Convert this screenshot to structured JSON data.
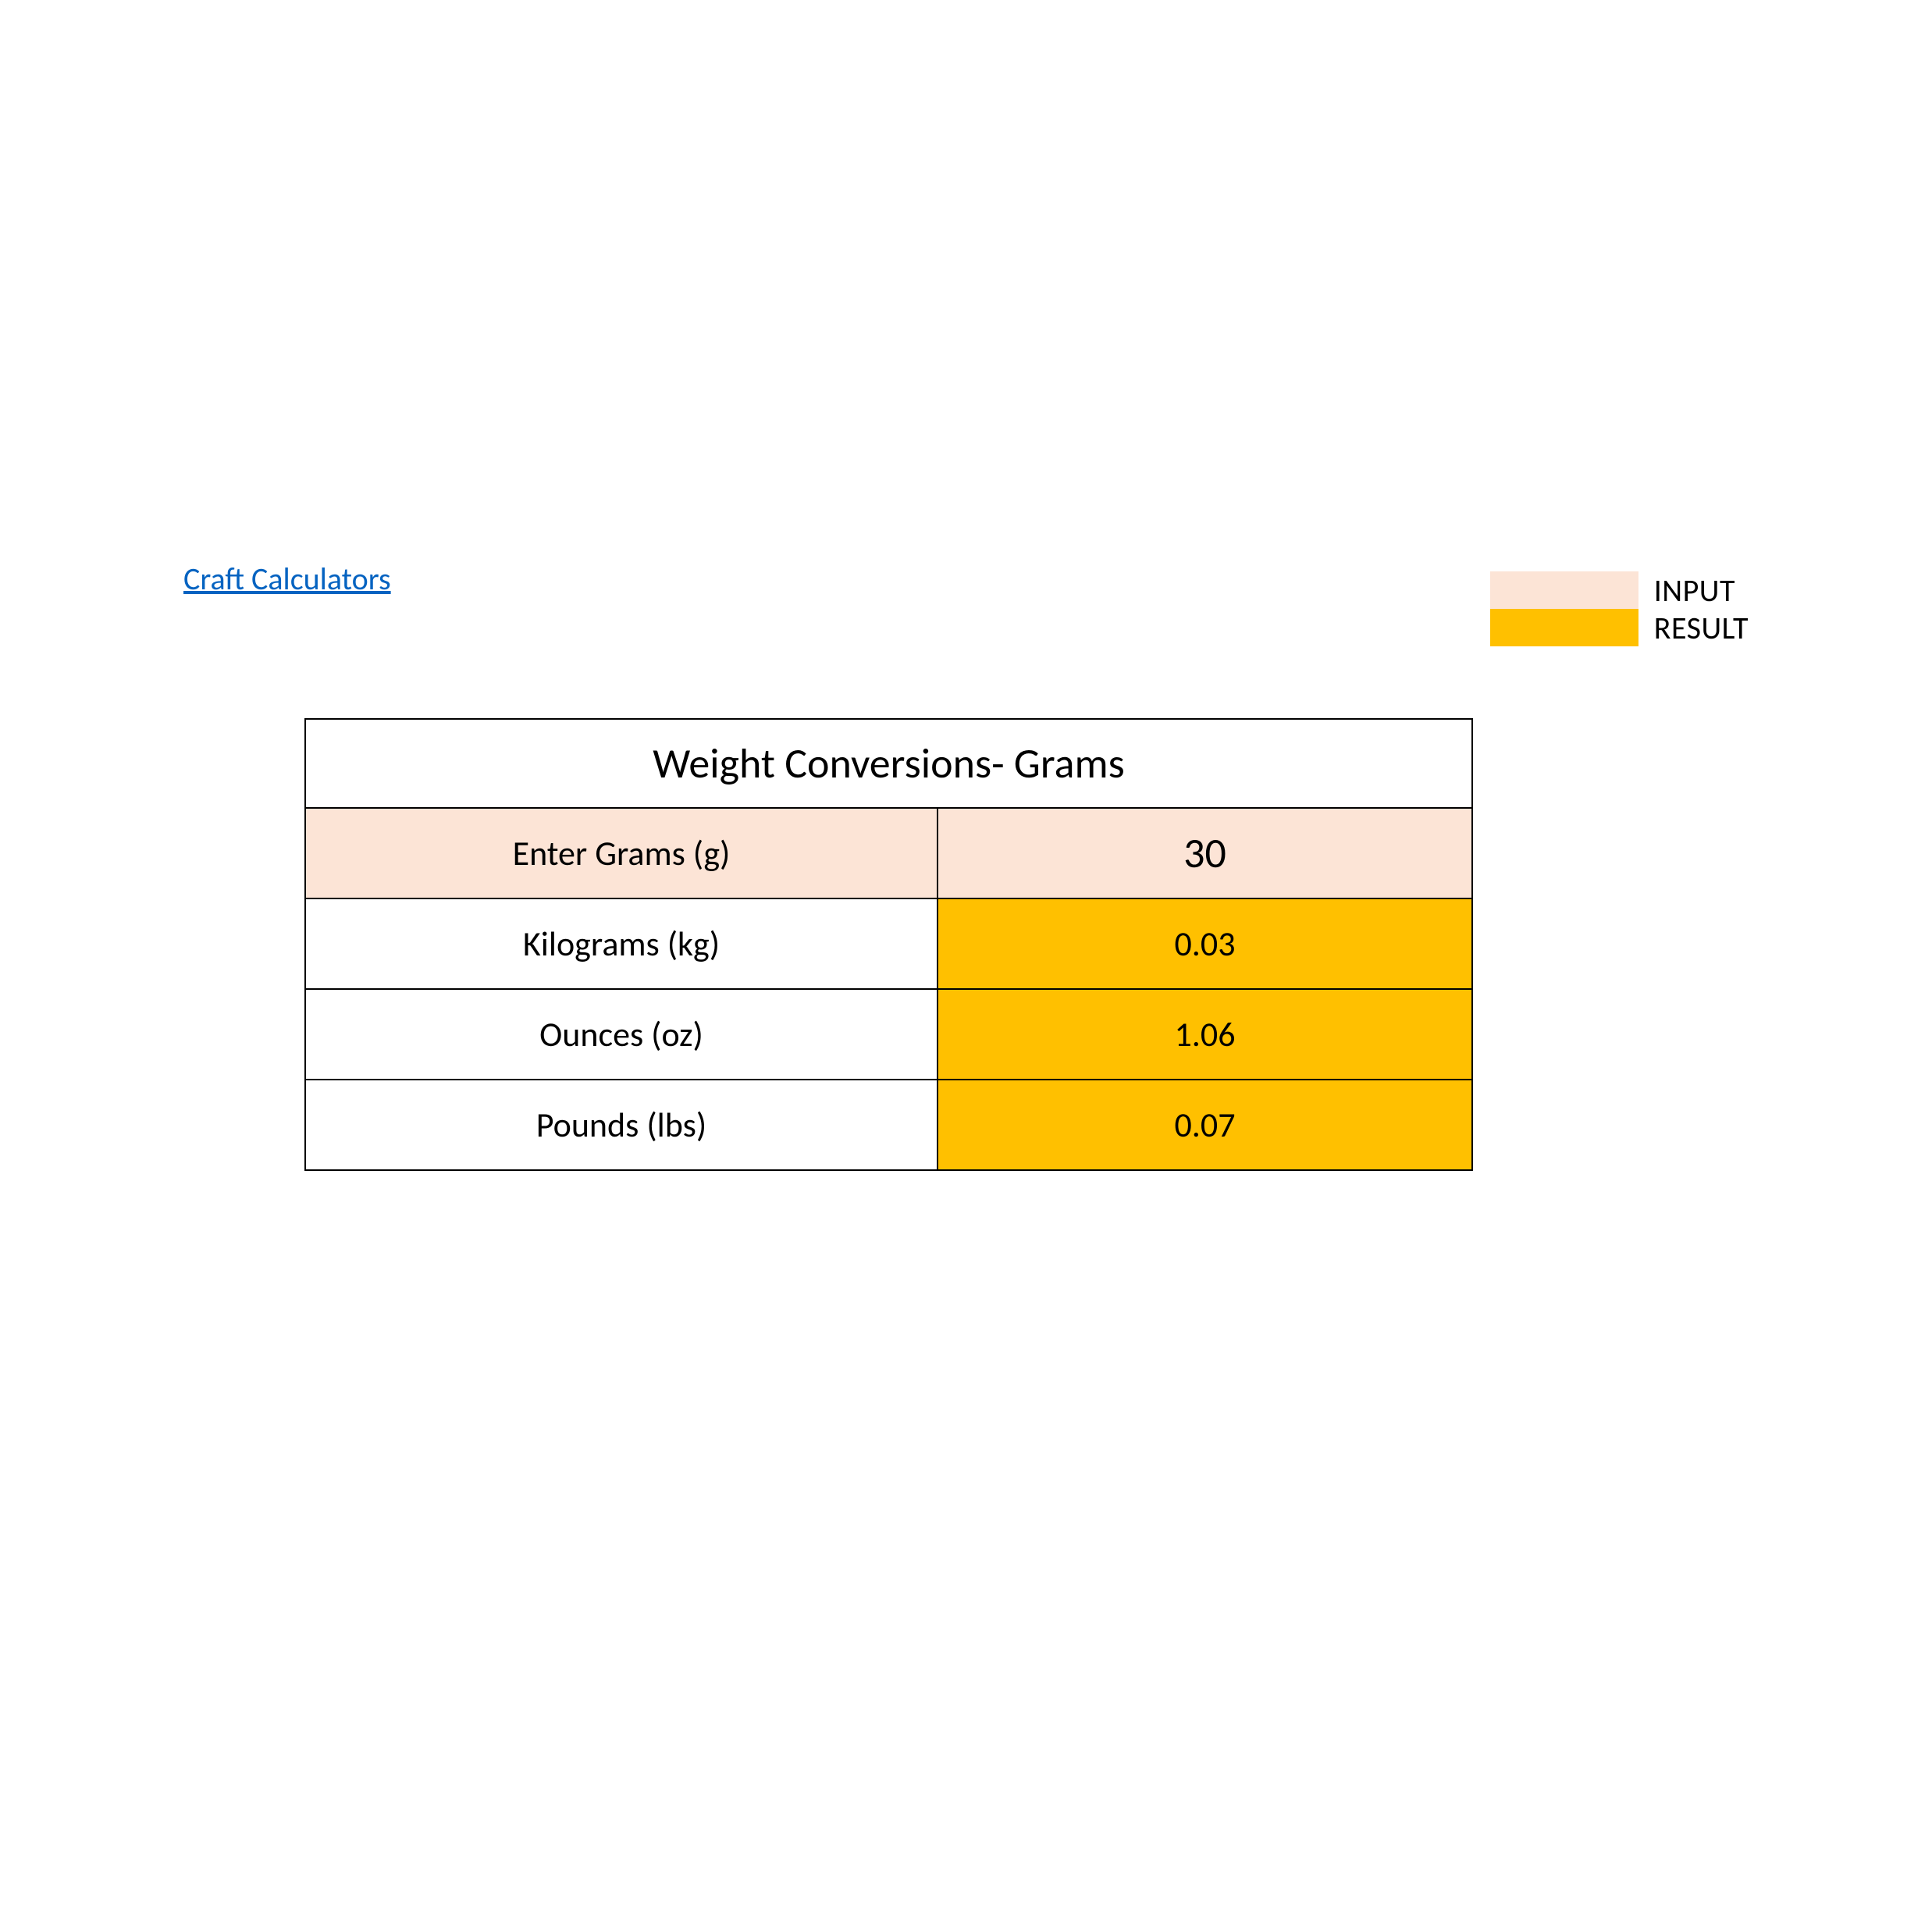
{
  "link": {
    "text": "Craft Calculators"
  },
  "legend": {
    "input_label": "INPUT",
    "result_label": "RESULT",
    "colors": {
      "input": "#FCE4D6",
      "result": "#FFC000"
    }
  },
  "table": {
    "title": "Weight Conversions- Grams",
    "rows": [
      {
        "kind": "input",
        "label": "Enter Grams (g)",
        "value": "30"
      },
      {
        "kind": "result",
        "label": "Kilograms (kg)",
        "value": "0.03"
      },
      {
        "kind": "result",
        "label": "Ounces (oz)",
        "value": "1.06"
      },
      {
        "kind": "result",
        "label": "Pounds (lbs)",
        "value": "0.07"
      }
    ]
  }
}
